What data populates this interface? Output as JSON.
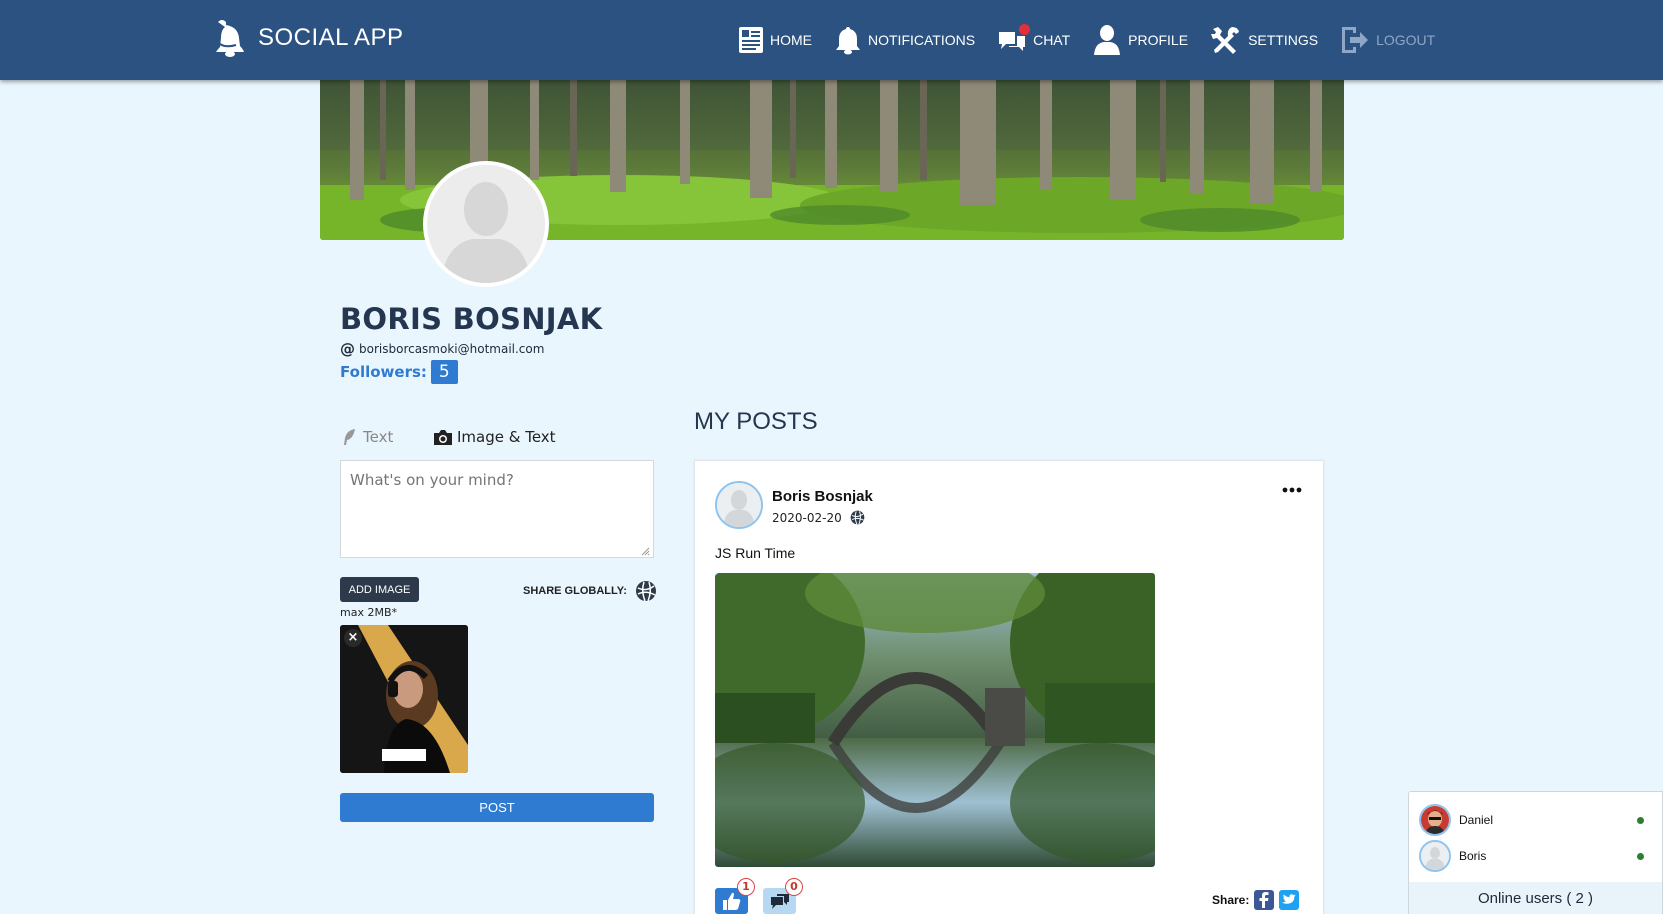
{
  "navbar": {
    "brand": "SOCIAL APP",
    "items": [
      {
        "label": "HOME"
      },
      {
        "label": "NOTIFICATIONS"
      },
      {
        "label": "CHAT"
      },
      {
        "label": "PROFILE"
      },
      {
        "label": "SETTINGS"
      },
      {
        "label": "LOGOUT"
      }
    ]
  },
  "profile": {
    "name": "BORIS BOSNJAK",
    "email": "borisborcasmoki@hotmail.com",
    "followers_label": "Followers:",
    "followers_count": "5"
  },
  "composer": {
    "tab_text": "Text",
    "tab_image_text": "Image & Text",
    "placeholder": "What's on your mind?",
    "add_image": "ADD IMAGE",
    "max_size": "max 2MB*",
    "share_globally": "SHARE GLOBALLY:",
    "remove_preview": "×",
    "post": "POST"
  },
  "posts": {
    "heading": "MY POSTS",
    "items": [
      {
        "author": "Boris Bosnjak",
        "date": "2020-02-20",
        "text": "JS Run Time",
        "likes": "1",
        "comments": "0",
        "share_label": "Share:"
      }
    ]
  },
  "online_users": {
    "users": [
      {
        "name": "Daniel"
      },
      {
        "name": "Boris"
      }
    ],
    "footer": "Online users ( 2 )"
  },
  "colors": {
    "navbar": "#2b5281",
    "accent": "#2f7bd1",
    "page_bg": "#eaf6fd",
    "online_dot": "#2e7d32",
    "notification_dot": "#e0303a"
  }
}
